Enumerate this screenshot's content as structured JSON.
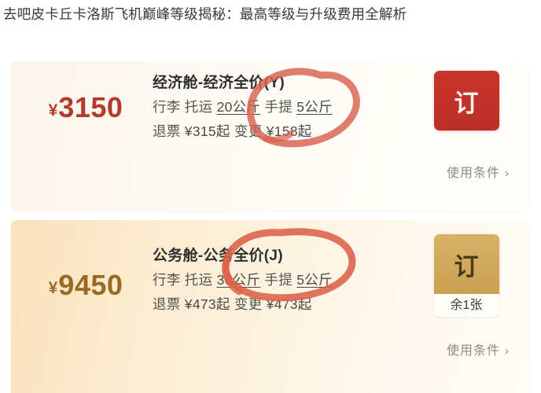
{
  "page": {
    "title": "去吧皮卡丘卡洛斯飞机巅峰等级揭秘：最高等级与升级费用全解析",
    "background_color": "#ffffff",
    "title_color": "#393939"
  },
  "annotation": {
    "color": "#d9614f",
    "shape": "hand-drawn-circle",
    "count": 2,
    "targets": [
      "经济全价(Y)",
      "公务全价(J)"
    ]
  },
  "cards": [
    {
      "id": "economy",
      "price": {
        "currency": "¥",
        "amount": "3150",
        "color": "#b5392c"
      },
      "cabin_name": "经济舱-经济全价(Y)",
      "baggage": {
        "label": "行李",
        "checked_label": "托运",
        "checked_value": "20公斤",
        "carryon_label": "手提",
        "carryon_value": "5公斤"
      },
      "fees": {
        "refund_label": "退票",
        "refund_value": "¥315起",
        "change_label": "变更",
        "change_value": "¥158起"
      },
      "book_button": {
        "label": "订",
        "color": "#bb2f27",
        "text_color": "#fdf2ec"
      },
      "stock_badge": null,
      "terms": {
        "label": "使用条件",
        "chevron": "›"
      }
    },
    {
      "id": "business",
      "price": {
        "currency": "¥",
        "amount": "9450",
        "color": "#9b6a22"
      },
      "cabin_name": "公务舱-公务全价(J)",
      "baggage": {
        "label": "行李",
        "checked_label": "托运",
        "checked_value": "30公斤",
        "carryon_label": "手提",
        "carryon_value": "5公斤"
      },
      "fees": {
        "refund_label": "退票",
        "refund_value": "¥473起",
        "change_label": "变更",
        "change_value": "¥473起"
      },
      "book_button": {
        "label": "订",
        "color": "#caa051",
        "text_color": "#4a3a1c"
      },
      "stock_badge": "余1张",
      "terms": {
        "label": "使用条件",
        "chevron": "›"
      }
    }
  ]
}
